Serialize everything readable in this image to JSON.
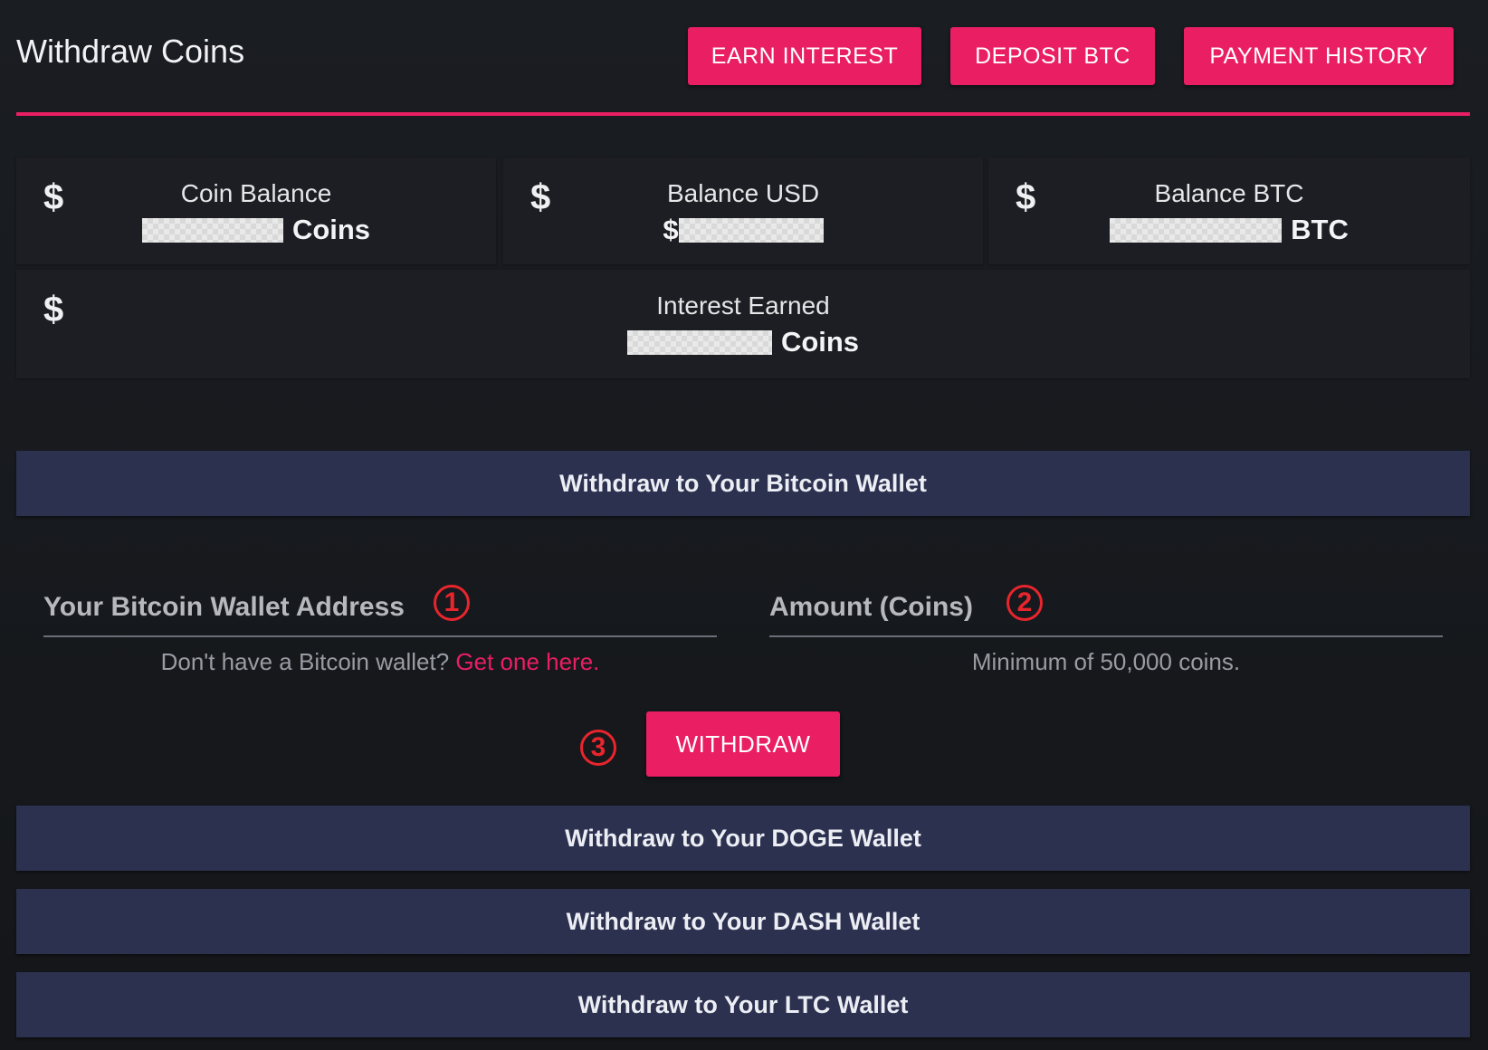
{
  "header": {
    "title": "Withdraw Coins",
    "buttons": {
      "earn_interest": "EARN INTEREST",
      "deposit_btc": "DEPOSIT BTC",
      "payment_history": "PAYMENT HISTORY"
    }
  },
  "stats": {
    "coin_balance": {
      "icon": "dollar-icon",
      "label": "Coin Balance",
      "prefix": "",
      "suffix": "Coins",
      "value_redacted": true
    },
    "balance_usd": {
      "icon": "dollar-icon",
      "label": "Balance USD",
      "prefix": "$",
      "suffix": "",
      "value_redacted": true
    },
    "balance_btc": {
      "icon": "dollar-icon",
      "label": "Balance BTC",
      "prefix": "",
      "suffix": "BTC",
      "value_redacted": true
    },
    "interest_earned": {
      "icon": "dollar-icon",
      "label": "Interest Earned",
      "prefix": "",
      "suffix": "Coins",
      "value_redacted": true
    },
    "dollar_glyph": "$"
  },
  "sections": {
    "bitcoin": "Withdraw to Your Bitcoin Wallet",
    "doge": "Withdraw to Your DOGE Wallet",
    "dash": "Withdraw to Your DASH Wallet",
    "ltc": "Withdraw to Your LTC Wallet"
  },
  "form": {
    "wallet_address": {
      "placeholder": "Your Bitcoin Wallet Address",
      "value": ""
    },
    "amount": {
      "placeholder": "Amount (Coins)",
      "value": ""
    },
    "wallet_help_text": "Don't have a Bitcoin wallet?",
    "wallet_help_link": "Get one here.",
    "amount_help_text": "Minimum of 50,000 coins.",
    "submit_label": "WITHDRAW"
  },
  "annotations": {
    "step_1": "1",
    "step_2": "2",
    "step_3": "3",
    "color": "#e8252d"
  },
  "colors": {
    "accent": "#e91e63",
    "section_bar": "#2c3150",
    "background": "#16181c",
    "card": "#1c1e23"
  }
}
